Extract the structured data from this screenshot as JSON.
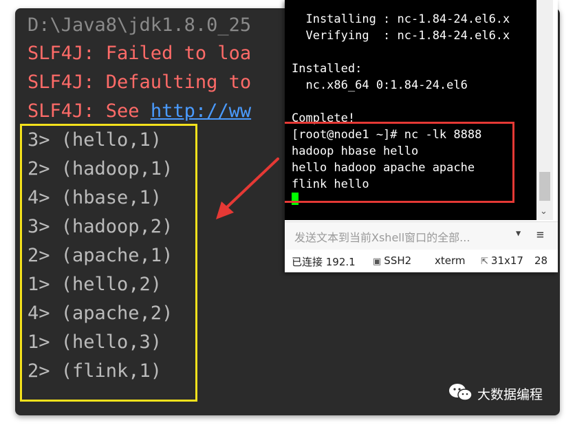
{
  "console": {
    "lines": [
      "D:\\Java8\\jdk1.8.0_25",
      "SLF4J: Failed to loa",
      "SLF4J: Defaulting to",
      "SLF4J: See "
    ],
    "link_text": "http://ww",
    "results": [
      "3> (hello,1)",
      "2> (hadoop,1)",
      "4> (hbase,1)",
      "3> (hadoop,2)",
      "2> (apache,1)",
      "1> (hello,2)",
      "4> (apache,2)",
      "1> (hello,3)",
      "2> (flink,1)"
    ]
  },
  "terminal": {
    "lines": [
      "  Installing : nc-1.84-24.el6.x",
      "  Verifying  : nc-1.84-24.el6.x",
      "",
      "Installed:",
      "  nc.x86_64 0:1.84-24.el6",
      "",
      "Complete!",
      "[root@node1 ~]# nc -lk 8888",
      "hadoop hbase hello",
      "hello hadoop apache apache",
      "flink hello"
    ]
  },
  "sendbar": {
    "placeholder": "发送文本到当前Xshell窗口的全部...",
    "dropdown_icon": "caret-down-icon",
    "menu_icon": "hamburger-menu-icon"
  },
  "statusbar": {
    "connection": "已连接 192.1",
    "protocol": "SSH2",
    "term": "xterm",
    "size": "31x17",
    "extra": "28"
  },
  "watermark": {
    "text": "大数据编程",
    "icon": "wechat-icon"
  },
  "colors": {
    "result_box": "#f5e21c",
    "highlight_box": "#e53935",
    "arrow": "#e53935",
    "error_text": "#ff6b68",
    "cursor": "#00ff00"
  }
}
